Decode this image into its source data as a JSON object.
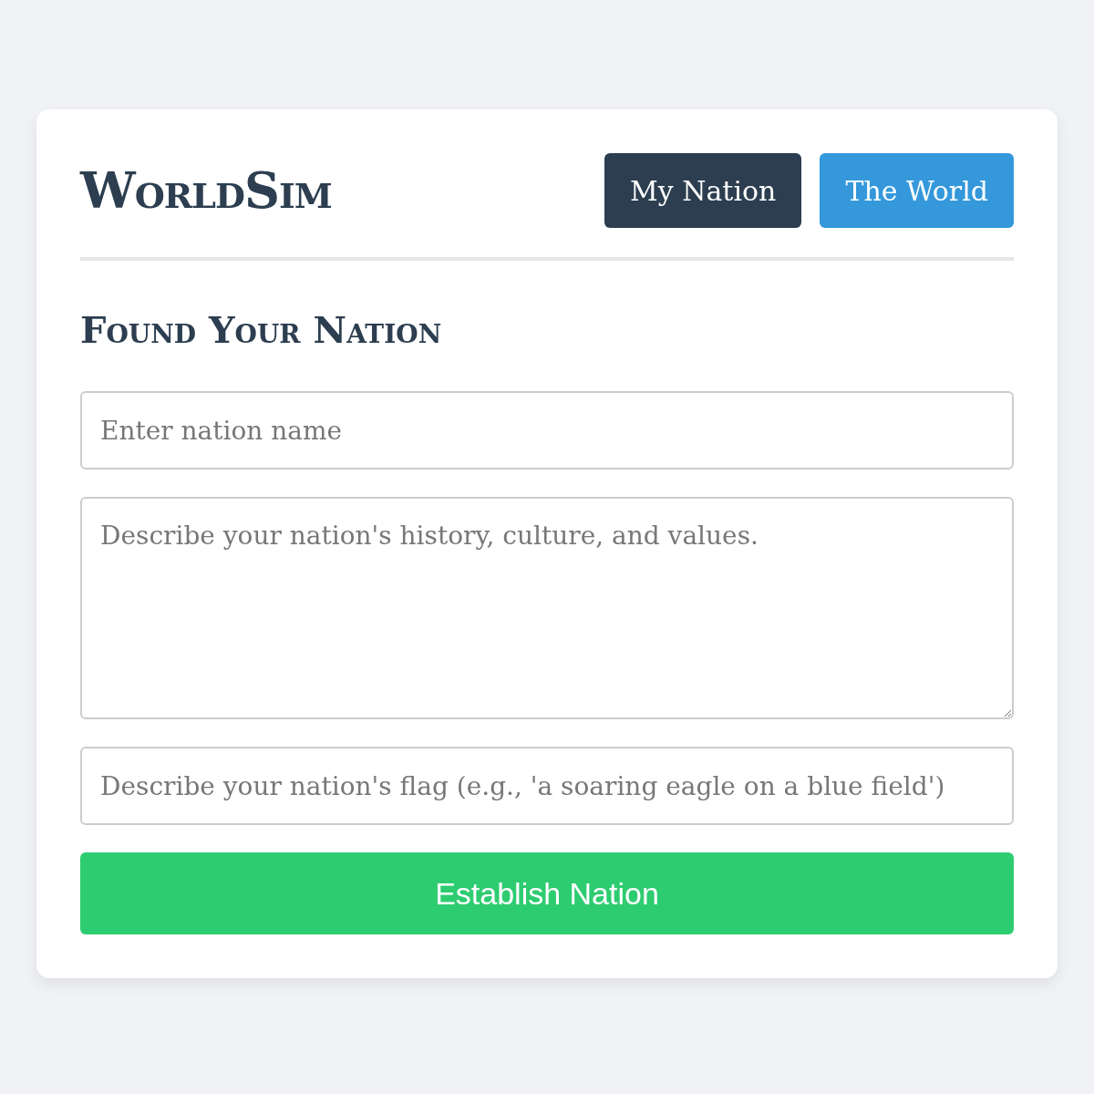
{
  "app_title": "WorldSim",
  "tabs": [
    {
      "label": "My Nation",
      "selected": true
    },
    {
      "label": "The World",
      "selected": false
    }
  ],
  "heading": "Found Your Nation",
  "form": {
    "name": {
      "placeholder": "Enter nation name"
    },
    "description": {
      "placeholder": "Describe your nation's history, culture, and values."
    },
    "flag": {
      "placeholder": "Describe your nation's flag (e.g., 'a soaring eagle on a blue field')"
    },
    "submit": "Establish Nation"
  }
}
